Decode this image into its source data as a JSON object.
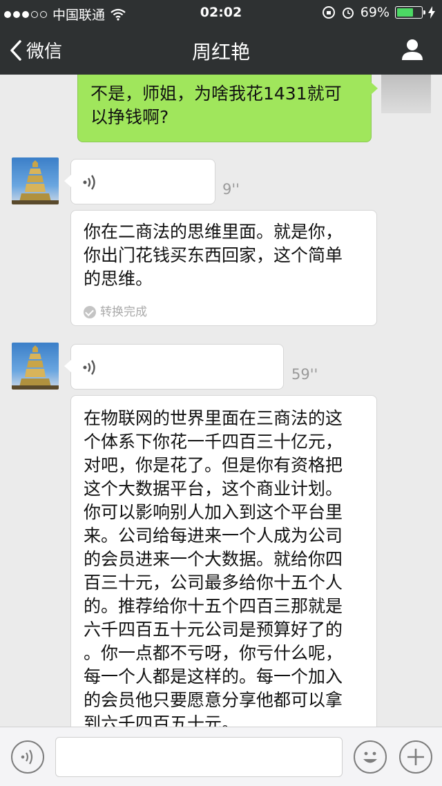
{
  "status_bar": {
    "carrier": "中国联通",
    "time": "02:02",
    "battery_percent": "69%",
    "battery_level": 0.69,
    "signal_bars_filled": 3,
    "signal_bars_total": 5
  },
  "nav": {
    "back_label": "微信",
    "title": "周红艳"
  },
  "messages": [
    {
      "side": "out",
      "type": "text",
      "text_lines": [
        "不是，师姐，为啥我花1431就可",
        "以挣钱啊?"
      ]
    },
    {
      "side": "in",
      "type": "voice",
      "duration": "9''"
    },
    {
      "side": "in",
      "type": "text",
      "text_lines": [
        "你在二商法的思维里面。就是你，",
        "你出门花钱买东西回家，这个简单",
        "的思维。"
      ],
      "status": "转换完成"
    },
    {
      "side": "in",
      "type": "voice",
      "duration": "59''"
    },
    {
      "side": "in",
      "type": "text",
      "text_lines": [
        "在物联网的世界里面在三商法的这",
        "个体系下你花一千四百三十亿元，",
        "对吧，你是花了。但是你有资格把",
        "这个大数据平台，这个商业计划。",
        "你可以影响别人加入到这个平台里",
        "来。公司给每进来一个人成为公司",
        "的会员进来一个大数据。就给你四",
        "百三十元，公司最多给你十五个人",
        "的。推荐给你十五个四百三那就是",
        "六千四百五十元公司是预算好了的",
        "。你一点都不亏呀，你亏什么呢，",
        "每一个人都是这样的。每一个加入",
        "的会员他只要愿意分享他都可以拿",
        "到六千四百五十元。"
      ]
    }
  ],
  "colors": {
    "header_bg": "#2e3132",
    "chat_bg": "#ebebeb",
    "outgoing_bubble": "#a0e65c",
    "incoming_bubble": "#ffffff",
    "battery_fill": "#4cd964"
  },
  "icons": {
    "back": "chevron-left-icon",
    "profile": "person-icon",
    "voice": "voice-wave-icon",
    "emoji": "smiley-icon",
    "more": "plus-icon"
  }
}
